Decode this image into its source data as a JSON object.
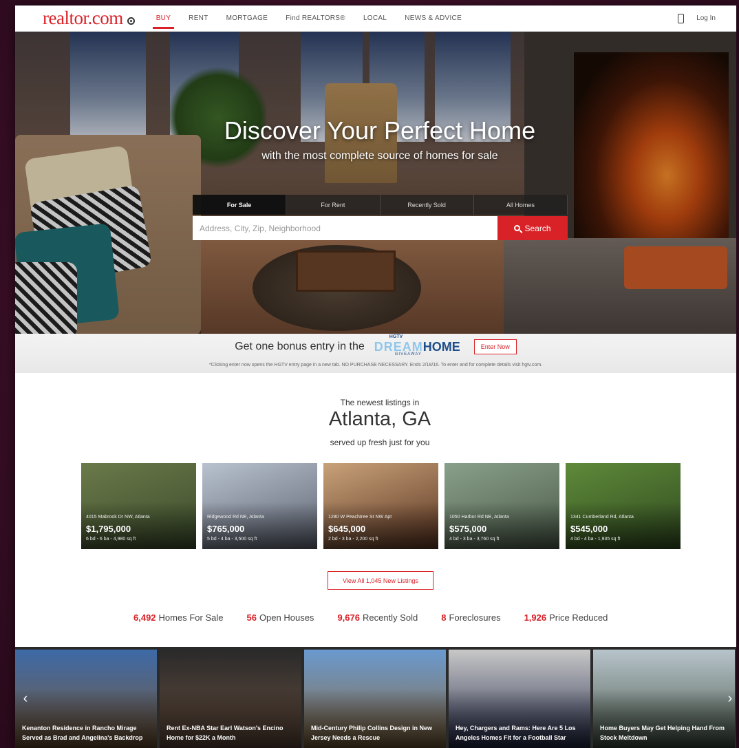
{
  "nav": {
    "logo": "realtor.com",
    "links": [
      "BUY",
      "RENT",
      "MORTGAGE",
      "Find REALTORS®",
      "LOCAL",
      "NEWS & ADVICE"
    ],
    "active_index": 0,
    "login": "Log In"
  },
  "hero": {
    "title": "Discover Your Perfect Home",
    "subtitle": "with the most complete source of homes for sale",
    "tabs": [
      "For Sale",
      "For Rent",
      "Recently Sold",
      "All Homes"
    ],
    "active_tab": 0,
    "search_placeholder": "Address, City, Zip, Neighborhood",
    "search_button": "Search"
  },
  "promo": {
    "text": "Get one bonus entry in the",
    "logo_brand": "HGTV",
    "logo_dream": "DREAM",
    "logo_home": "HOME",
    "logo_giveaway": "GIVEAWAY",
    "button": "Enter Now",
    "fine_print": "*Clicking enter now opens the HGTV entry page in a new tab. NO PURCHASE NECESSARY. Ends 2/18/16. To enter and for complete details visit hgtv.com."
  },
  "newest": {
    "kicker": "The newest listings in",
    "city": "Atlanta, GA",
    "sub": "served up fresh just for you"
  },
  "listings": [
    {
      "address": "4015 Mabrook Dr NW, Atlanta",
      "price": "$1,795,000",
      "specs": "6 bd - 6 ba - 4,980 sq ft",
      "colors": [
        "#6b7a4a",
        "#3a4a2a"
      ]
    },
    {
      "address": "Ridgewood Rd NE, Atlanta",
      "price": "$765,000",
      "specs": "5 bd - 4 ba - 3,500 sq ft",
      "colors": [
        "#b9c2cf",
        "#5c6270"
      ]
    },
    {
      "address": "1280 W Peachtree St NW Apt",
      "price": "$645,000",
      "specs": "2 bd - 3 ba - 2,200 sq ft",
      "colors": [
        "#c9a27a",
        "#5a3420"
      ]
    },
    {
      "address": "1050 Harbor Rd NE, Atlanta",
      "price": "$575,000",
      "specs": "4 bd - 3 ba - 3,760 sq ft",
      "colors": [
        "#8aa08a",
        "#4a5a48"
      ]
    },
    {
      "address": "1341 Cumberland Rd, Atlanta",
      "price": "$545,000",
      "specs": "4 bd - 4 ba - 1,935 sq ft",
      "colors": [
        "#5f8a3a",
        "#2f4a1f"
      ]
    }
  ],
  "view_all": "View All 1,045 New Listings",
  "stats": [
    {
      "num": "6,492",
      "label": "Homes For Sale"
    },
    {
      "num": "56",
      "label": "Open Houses"
    },
    {
      "num": "9,676",
      "label": "Recently Sold"
    },
    {
      "num": "8",
      "label": "Foreclosures"
    },
    {
      "num": "1,926",
      "label": "Price Reduced"
    }
  ],
  "news": [
    {
      "caption": "Kenanton Residence in Rancho Mirage Served as Brad and Angelina's Backdrop",
      "colors": [
        "#3d6aa8",
        "#7a5a38"
      ]
    },
    {
      "caption": "Rent Ex-NBA Star Earl Watson's Encino Home for $22K a Month",
      "colors": [
        "#2a2a2a",
        "#6a5040"
      ]
    },
    {
      "caption": "Mid-Century Philip Collins Design in New Jersey Needs a Rescue",
      "colors": [
        "#6a9ad0",
        "#8a6a40"
      ]
    },
    {
      "caption": "Hey, Chargers and Rams: Here Are 5 Los Angeles Homes Fit for a Football Star",
      "colors": [
        "#c8c8c8",
        "#2a3050"
      ]
    },
    {
      "caption": "Home Buyers May Get Helping Hand From Stock Meltdown",
      "colors": [
        "#b8c4cc",
        "#4a5a4a"
      ]
    }
  ],
  "news_prev": "‹",
  "news_next": "›",
  "brand_color": "#d92228"
}
